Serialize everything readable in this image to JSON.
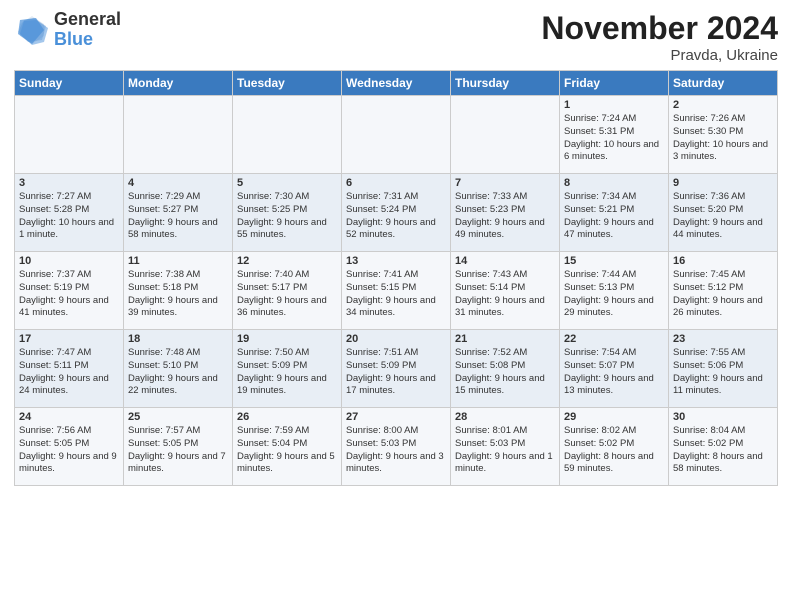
{
  "header": {
    "logo_general": "General",
    "logo_blue": "Blue",
    "title": "November 2024",
    "subtitle": "Pravda, Ukraine"
  },
  "days_of_week": [
    "Sunday",
    "Monday",
    "Tuesday",
    "Wednesday",
    "Thursday",
    "Friday",
    "Saturday"
  ],
  "weeks": [
    [
      {
        "day": "",
        "info": ""
      },
      {
        "day": "",
        "info": ""
      },
      {
        "day": "",
        "info": ""
      },
      {
        "day": "",
        "info": ""
      },
      {
        "day": "",
        "info": ""
      },
      {
        "day": "1",
        "info": "Sunrise: 7:24 AM\nSunset: 5:31 PM\nDaylight: 10 hours\nand 6 minutes."
      },
      {
        "day": "2",
        "info": "Sunrise: 7:26 AM\nSunset: 5:30 PM\nDaylight: 10 hours\nand 3 minutes."
      }
    ],
    [
      {
        "day": "3",
        "info": "Sunrise: 7:27 AM\nSunset: 5:28 PM\nDaylight: 10 hours\nand 1 minute."
      },
      {
        "day": "4",
        "info": "Sunrise: 7:29 AM\nSunset: 5:27 PM\nDaylight: 9 hours\nand 58 minutes."
      },
      {
        "day": "5",
        "info": "Sunrise: 7:30 AM\nSunset: 5:25 PM\nDaylight: 9 hours\nand 55 minutes."
      },
      {
        "day": "6",
        "info": "Sunrise: 7:31 AM\nSunset: 5:24 PM\nDaylight: 9 hours\nand 52 minutes."
      },
      {
        "day": "7",
        "info": "Sunrise: 7:33 AM\nSunset: 5:23 PM\nDaylight: 9 hours\nand 49 minutes."
      },
      {
        "day": "8",
        "info": "Sunrise: 7:34 AM\nSunset: 5:21 PM\nDaylight: 9 hours\nand 47 minutes."
      },
      {
        "day": "9",
        "info": "Sunrise: 7:36 AM\nSunset: 5:20 PM\nDaylight: 9 hours\nand 44 minutes."
      }
    ],
    [
      {
        "day": "10",
        "info": "Sunrise: 7:37 AM\nSunset: 5:19 PM\nDaylight: 9 hours\nand 41 minutes."
      },
      {
        "day": "11",
        "info": "Sunrise: 7:38 AM\nSunset: 5:18 PM\nDaylight: 9 hours\nand 39 minutes."
      },
      {
        "day": "12",
        "info": "Sunrise: 7:40 AM\nSunset: 5:17 PM\nDaylight: 9 hours\nand 36 minutes."
      },
      {
        "day": "13",
        "info": "Sunrise: 7:41 AM\nSunset: 5:15 PM\nDaylight: 9 hours\nand 34 minutes."
      },
      {
        "day": "14",
        "info": "Sunrise: 7:43 AM\nSunset: 5:14 PM\nDaylight: 9 hours\nand 31 minutes."
      },
      {
        "day": "15",
        "info": "Sunrise: 7:44 AM\nSunset: 5:13 PM\nDaylight: 9 hours\nand 29 minutes."
      },
      {
        "day": "16",
        "info": "Sunrise: 7:45 AM\nSunset: 5:12 PM\nDaylight: 9 hours\nand 26 minutes."
      }
    ],
    [
      {
        "day": "17",
        "info": "Sunrise: 7:47 AM\nSunset: 5:11 PM\nDaylight: 9 hours\nand 24 minutes."
      },
      {
        "day": "18",
        "info": "Sunrise: 7:48 AM\nSunset: 5:10 PM\nDaylight: 9 hours\nand 22 minutes."
      },
      {
        "day": "19",
        "info": "Sunrise: 7:50 AM\nSunset: 5:09 PM\nDaylight: 9 hours\nand 19 minutes."
      },
      {
        "day": "20",
        "info": "Sunrise: 7:51 AM\nSunset: 5:09 PM\nDaylight: 9 hours\nand 17 minutes."
      },
      {
        "day": "21",
        "info": "Sunrise: 7:52 AM\nSunset: 5:08 PM\nDaylight: 9 hours\nand 15 minutes."
      },
      {
        "day": "22",
        "info": "Sunrise: 7:54 AM\nSunset: 5:07 PM\nDaylight: 9 hours\nand 13 minutes."
      },
      {
        "day": "23",
        "info": "Sunrise: 7:55 AM\nSunset: 5:06 PM\nDaylight: 9 hours\nand 11 minutes."
      }
    ],
    [
      {
        "day": "24",
        "info": "Sunrise: 7:56 AM\nSunset: 5:05 PM\nDaylight: 9 hours\nand 9 minutes."
      },
      {
        "day": "25",
        "info": "Sunrise: 7:57 AM\nSunset: 5:05 PM\nDaylight: 9 hours\nand 7 minutes."
      },
      {
        "day": "26",
        "info": "Sunrise: 7:59 AM\nSunset: 5:04 PM\nDaylight: 9 hours\nand 5 minutes."
      },
      {
        "day": "27",
        "info": "Sunrise: 8:00 AM\nSunset: 5:03 PM\nDaylight: 9 hours\nand 3 minutes."
      },
      {
        "day": "28",
        "info": "Sunrise: 8:01 AM\nSunset: 5:03 PM\nDaylight: 9 hours\nand 1 minute."
      },
      {
        "day": "29",
        "info": "Sunrise: 8:02 AM\nSunset: 5:02 PM\nDaylight: 8 hours\nand 59 minutes."
      },
      {
        "day": "30",
        "info": "Sunrise: 8:04 AM\nSunset: 5:02 PM\nDaylight: 8 hours\nand 58 minutes."
      }
    ]
  ]
}
